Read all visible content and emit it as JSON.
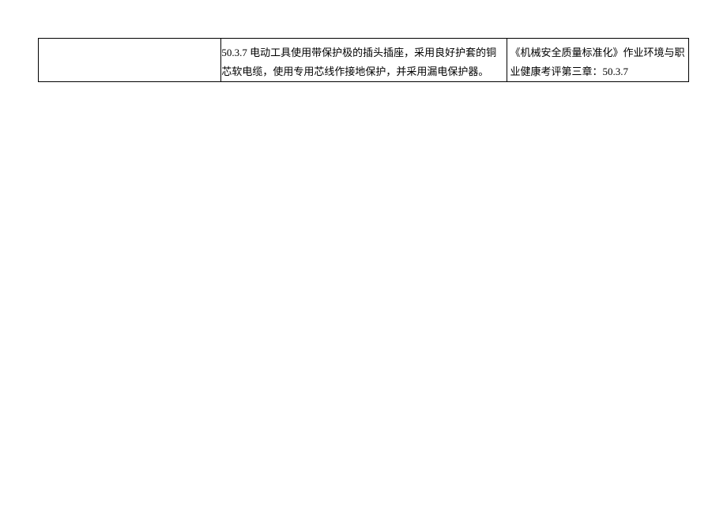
{
  "table": {
    "row": {
      "leftCell": "",
      "middleCell": "50.3.7 电动工具使用带保护极的插头插座，采用良好护套的铜芯软电缆，使用专用芯线作接地保护，并采用漏电保护器。",
      "rightCell": "《机械安全质量标准化》作业环境与职业健康考评第三章：50.3.7"
    }
  }
}
